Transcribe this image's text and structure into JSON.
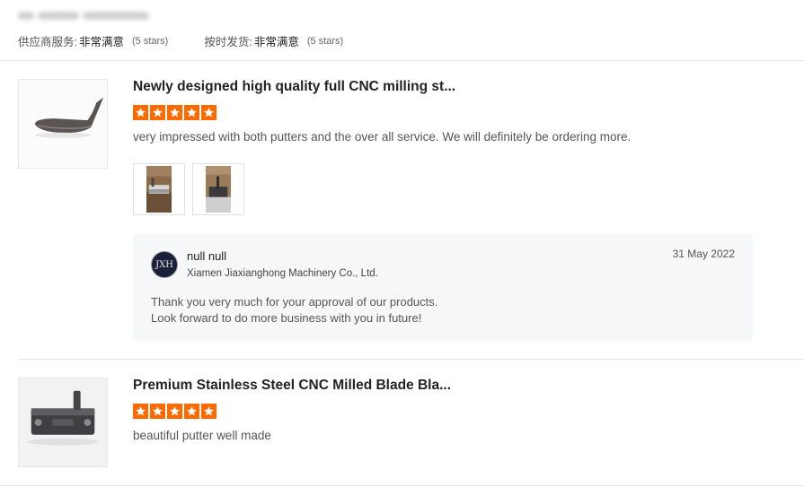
{
  "header": {
    "service_label": "供应商服务:",
    "service_value": "非常满意",
    "service_stars": "(5 stars)",
    "shipping_label": "按时发货:",
    "shipping_value": "非常满意",
    "shipping_stars": "(5 stars)"
  },
  "reviews": [
    {
      "title": "Newly designed high quality full CNC milling st...",
      "rating": 5,
      "text": "very impressed with both putters and the over all service. We will definitely be ordering more.",
      "photos": [
        "photo",
        "photo"
      ],
      "reply": {
        "avatar_text": "JXH",
        "name": "null null",
        "company": "Xiamen Jiaxianghong Machinery Co., Ltd.",
        "date": "31 May 2022",
        "message_line1": "Thank you very much for your approval of our products.",
        "message_line2": "Look forward to do more business with you in future!"
      }
    },
    {
      "title": "Premium Stainless Steel CNC Milled Blade Bla...",
      "rating": 5,
      "text": "beautiful putter well made"
    }
  ],
  "colors": {
    "star": "#ff6a00",
    "reply_bg": "#f6f7f9",
    "divider": "#e5e5e5"
  }
}
